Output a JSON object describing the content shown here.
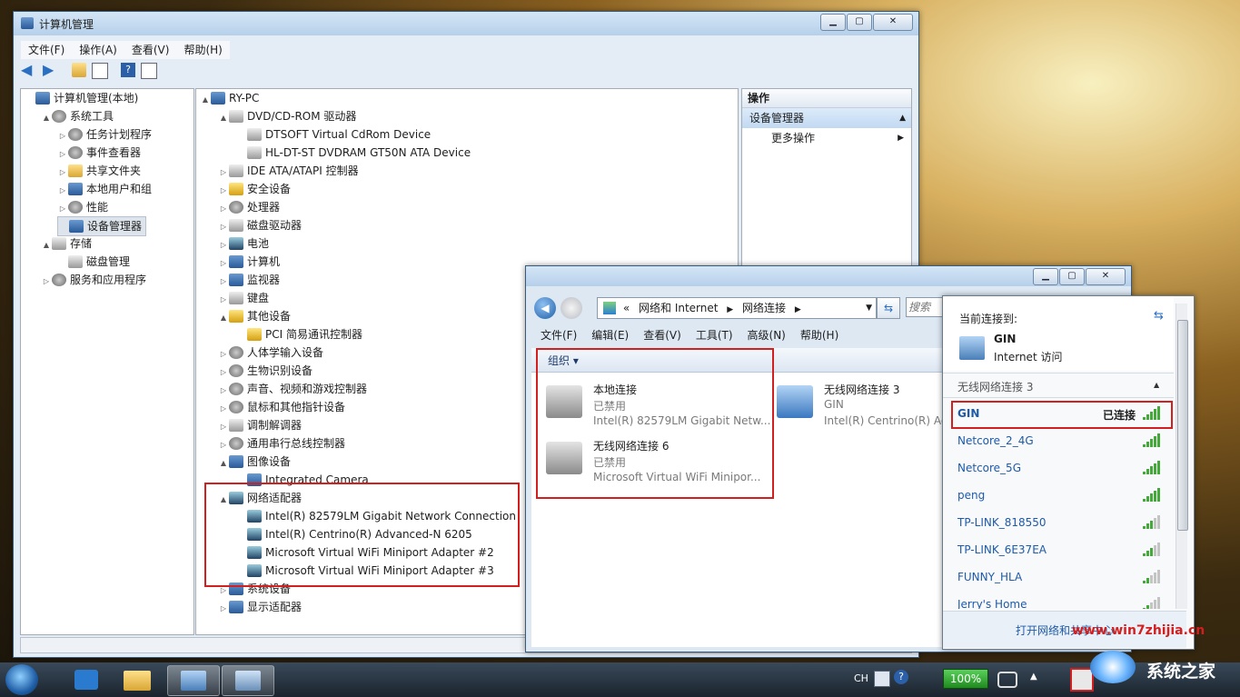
{
  "cm": {
    "title": "计算机管理",
    "menu": [
      "文件(F)",
      "操作(A)",
      "查看(V)",
      "帮助(H)"
    ],
    "tree": [
      {
        "label": "计算机管理(本地)",
        "depth": 0,
        "arrow": "",
        "icon": "pc"
      },
      {
        "label": "系统工具",
        "depth": 1,
        "arrow": "▲",
        "icon": "gear"
      },
      {
        "label": "任务计划程序",
        "depth": 2,
        "arrow": "▷",
        "icon": "gear"
      },
      {
        "label": "事件查看器",
        "depth": 2,
        "arrow": "▷",
        "icon": "gear"
      },
      {
        "label": "共享文件夹",
        "depth": 2,
        "arrow": "▷",
        "icon": "folder"
      },
      {
        "label": "本地用户和组",
        "depth": 2,
        "arrow": "▷",
        "icon": "pc"
      },
      {
        "label": "性能",
        "depth": 2,
        "arrow": "▷",
        "icon": "gear"
      },
      {
        "label": "设备管理器",
        "depth": 2,
        "arrow": "",
        "icon": "pc"
      },
      {
        "label": "存储",
        "depth": 1,
        "arrow": "▲",
        "icon": "disk"
      },
      {
        "label": "磁盘管理",
        "depth": 2,
        "arrow": "",
        "icon": "disk"
      },
      {
        "label": "服务和应用程序",
        "depth": 1,
        "arrow": "▷",
        "icon": "gear"
      }
    ],
    "devices": [
      {
        "label": "RY-PC",
        "depth": 0,
        "arrow": "▲",
        "icon": "pc"
      },
      {
        "label": "DVD/CD-ROM 驱动器",
        "depth": 1,
        "arrow": "▲",
        "icon": "disk"
      },
      {
        "label": "DTSOFT Virtual CdRom Device",
        "depth": 2,
        "arrow": "",
        "icon": "disk"
      },
      {
        "label": "HL-DT-ST DVDRAM GT50N ATA Device",
        "depth": 2,
        "arrow": "",
        "icon": "disk"
      },
      {
        "label": "IDE ATA/ATAPI 控制器",
        "depth": 1,
        "arrow": "▷",
        "icon": "disk"
      },
      {
        "label": "安全设备",
        "depth": 1,
        "arrow": "▷",
        "icon": "warn"
      },
      {
        "label": "处理器",
        "depth": 1,
        "arrow": "▷",
        "icon": "gear"
      },
      {
        "label": "磁盘驱动器",
        "depth": 1,
        "arrow": "▷",
        "icon": "disk"
      },
      {
        "label": "电池",
        "depth": 1,
        "arrow": "▷",
        "icon": "net"
      },
      {
        "label": "计算机",
        "depth": 1,
        "arrow": "▷",
        "icon": "pc"
      },
      {
        "label": "监视器",
        "depth": 1,
        "arrow": "▷",
        "icon": "pc"
      },
      {
        "label": "键盘",
        "depth": 1,
        "arrow": "▷",
        "icon": "disk"
      },
      {
        "label": "其他设备",
        "depth": 1,
        "arrow": "▲",
        "icon": "warn"
      },
      {
        "label": "PCI 简易通讯控制器",
        "depth": 2,
        "arrow": "",
        "icon": "warn"
      },
      {
        "label": "人体学输入设备",
        "depth": 1,
        "arrow": "▷",
        "icon": "gear"
      },
      {
        "label": "生物识别设备",
        "depth": 1,
        "arrow": "▷",
        "icon": "gear"
      },
      {
        "label": "声音、视频和游戏控制器",
        "depth": 1,
        "arrow": "▷",
        "icon": "gear"
      },
      {
        "label": "鼠标和其他指针设备",
        "depth": 1,
        "arrow": "▷",
        "icon": "gear"
      },
      {
        "label": "调制解调器",
        "depth": 1,
        "arrow": "▷",
        "icon": "disk"
      },
      {
        "label": "通用串行总线控制器",
        "depth": 1,
        "arrow": "▷",
        "icon": "gear"
      },
      {
        "label": "图像设备",
        "depth": 1,
        "arrow": "▲",
        "icon": "pc"
      },
      {
        "label": "Integrated Camera",
        "depth": 2,
        "arrow": "",
        "icon": "pc"
      },
      {
        "label": "网络适配器",
        "depth": 1,
        "arrow": "▲",
        "icon": "net"
      },
      {
        "label": "Intel(R) 82579LM Gigabit Network Connection",
        "depth": 2,
        "arrow": "",
        "icon": "net"
      },
      {
        "label": "Intel(R) Centrino(R) Advanced-N 6205",
        "depth": 2,
        "arrow": "",
        "icon": "net"
      },
      {
        "label": "Microsoft Virtual WiFi Miniport Adapter #2",
        "depth": 2,
        "arrow": "",
        "icon": "net"
      },
      {
        "label": "Microsoft Virtual WiFi Miniport Adapter #3",
        "depth": 2,
        "arrow": "",
        "icon": "net"
      },
      {
        "label": "系统设备",
        "depth": 1,
        "arrow": "▷",
        "icon": "pc"
      },
      {
        "label": "显示适配器",
        "depth": 1,
        "arrow": "▷",
        "icon": "pc"
      }
    ],
    "actions": {
      "header": "操作",
      "section": "设备管理器",
      "more": "更多操作"
    }
  },
  "nc": {
    "breadcrumb": {
      "sep": "«",
      "a": "网络和 Internet",
      "b": "网络连接"
    },
    "search_placeholder": "搜索",
    "menu": [
      "文件(F)",
      "编辑(E)",
      "查看(V)",
      "工具(T)",
      "高级(N)",
      "帮助(H)"
    ],
    "organize": "组织 ▾",
    "connections": [
      {
        "name": "本地连接",
        "status": "已禁用",
        "device": "Intel(R) 82579LM Gigabit Netw..."
      },
      {
        "name": "无线网络连接 6",
        "status": "已禁用",
        "device": "Microsoft Virtual WiFi Minipor..."
      },
      {
        "name": "无线网络连接 3",
        "status": "GIN",
        "device": "Intel(R) Centrino(R) Ad"
      }
    ]
  },
  "wifi": {
    "current_label": "当前连接到:",
    "net_name": "GIN",
    "net_access": "Internet 访问",
    "section": "无线网络连接 3",
    "connected_text": "已连接",
    "networks": [
      {
        "ssid": "GIN",
        "bars": 5
      },
      {
        "ssid": "Netcore_2_4G",
        "bars": 5
      },
      {
        "ssid": "Netcore_5G",
        "bars": 5
      },
      {
        "ssid": "peng",
        "bars": 5
      },
      {
        "ssid": "TP-LINK_818550",
        "bars": 3
      },
      {
        "ssid": "TP-LINK_6E37EA",
        "bars": 3
      },
      {
        "ssid": "FUNNY_HLA",
        "bars": 2
      },
      {
        "ssid": "Jerry's Home",
        "bars": 2
      }
    ],
    "footer": "打开网络和共享中心"
  },
  "taskbar": {
    "lang": "CH",
    "battery": "100%"
  },
  "watermark": {
    "site": "www.win7zhijia.cn",
    "brand": "系统之家"
  }
}
